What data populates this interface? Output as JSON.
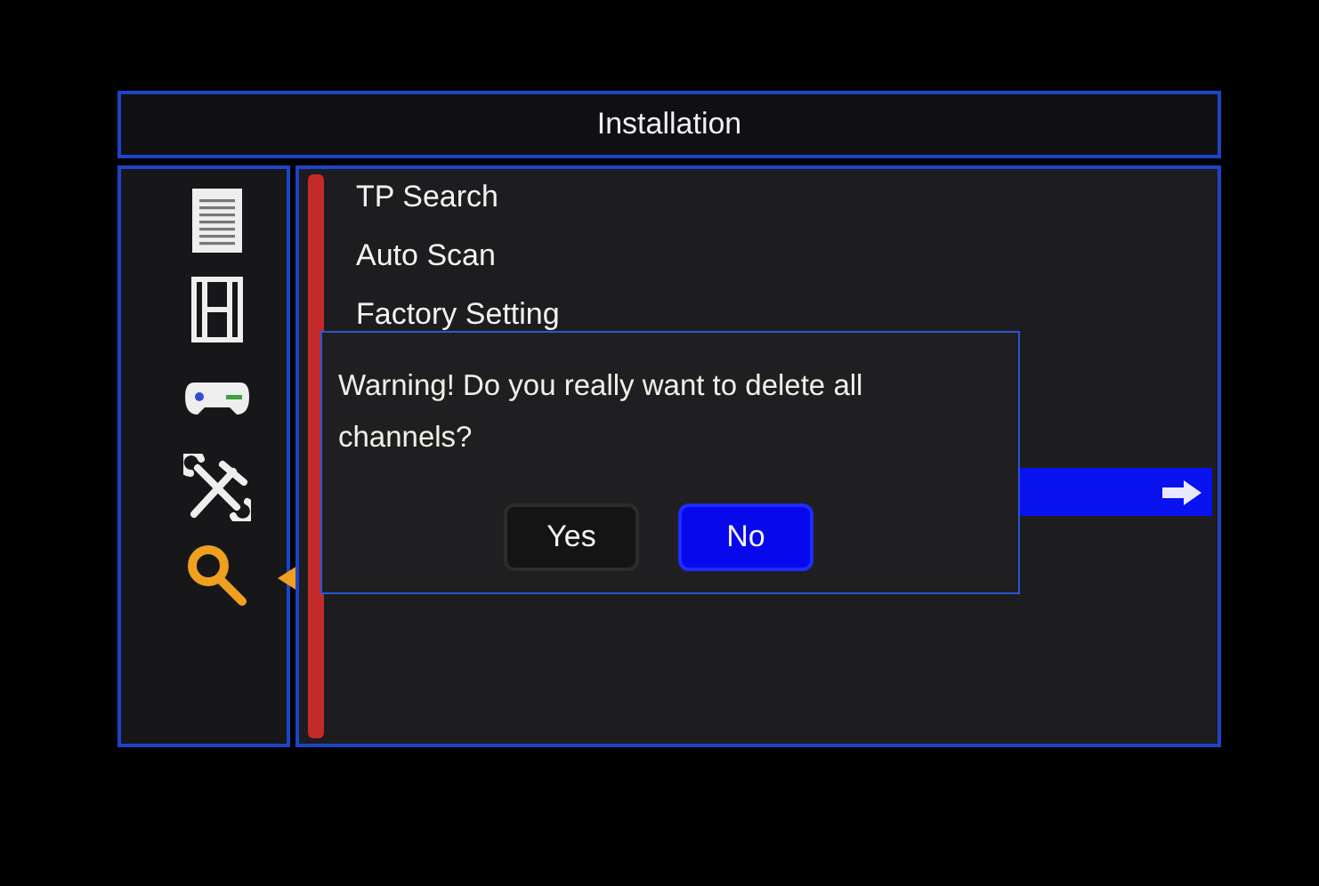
{
  "window": {
    "title": "Installation"
  },
  "sidebar": {
    "items": [
      {
        "selected": false
      },
      {
        "selected": false
      },
      {
        "selected": false
      },
      {
        "selected": false
      },
      {
        "selected": true
      }
    ]
  },
  "menu": {
    "items": [
      {
        "label": "TP Search",
        "selected": false
      },
      {
        "label": "Auto Scan",
        "selected": false
      },
      {
        "label": "Factory Setting",
        "selected": false
      },
      {
        "selected": true
      }
    ]
  },
  "dialog": {
    "message": "Warning! Do you really want to delete all channels?",
    "buttons": [
      {
        "label": "Yes",
        "selected": false
      },
      {
        "label": "No",
        "selected": true
      }
    ]
  }
}
